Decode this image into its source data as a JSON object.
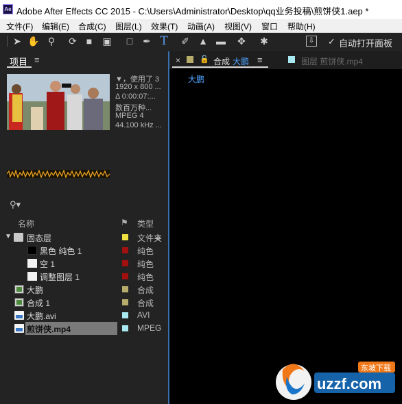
{
  "window": {
    "title": "Adobe After Effects CC 2015 - C:\\Users\\Administrator\\Desktop\\qq业务投稿\\煎饼侠1.aep *",
    "logo_text": "Ae"
  },
  "menu": [
    "文件(F)",
    "编辑(E)",
    "合成(C)",
    "图层(L)",
    "效果(T)",
    "动画(A)",
    "视图(V)",
    "窗口",
    "帮助(H)"
  ],
  "toolbar": {
    "tools": [
      "selection-icon",
      "hand-icon",
      "zoom-icon",
      "rotate-icon",
      "camera-icon",
      "pan-behind-icon",
      "rectangle-icon",
      "pen-icon",
      "text-icon",
      "brush-icon",
      "clone-stamp-icon",
      "eraser-icon",
      "roto-brush-icon",
      "puppet-pin-icon"
    ],
    "auto_open_label": "自动打开面板",
    "auto_open_checked": true
  },
  "project": {
    "tab_label": "项目",
    "tab_menu": "≡",
    "info": [
      "▼，使用了 3",
      "1920 x 800 ...",
      "Δ 0:00:07:...",
      "数百万种...",
      "MPEG 4",
      "44.100 kHz ..."
    ],
    "search_icon": "search-icon",
    "col_name": "名称",
    "col_type": "类型",
    "rows": [
      {
        "name": "固态层",
        "type": "文件夹",
        "icon": "folder-icon",
        "color": "#f0e040",
        "expanded": true
      },
      {
        "name": "黑色 纯色 1",
        "type": "纯色",
        "icon": "solid-black-icon",
        "color": "#a31010"
      },
      {
        "name": "空 1",
        "type": "纯色",
        "icon": "solid-white-icon",
        "color": "#a31010"
      },
      {
        "name": "调整图层 1",
        "type": "纯色",
        "icon": "solid-white-icon",
        "color": "#a31010"
      },
      {
        "name": "大鹏",
        "type": "合成",
        "icon": "composition-icon",
        "color": "#b8ac6c"
      },
      {
        "name": "合成 1",
        "type": "合成",
        "icon": "composition-icon",
        "color": "#b8ac6c"
      },
      {
        "name": "大鹏.avi",
        "type": "AVI",
        "icon": "video-file-icon",
        "color": "#a8e8f0"
      },
      {
        "name": "煎饼侠.mp4",
        "type": "MPEG",
        "icon": "video-file-icon",
        "color": "#a8e8f0",
        "selected": true
      }
    ]
  },
  "composition": {
    "tab_close": "×",
    "tab_prefix": "合成",
    "tab_name": "大鹏",
    "tab_menu": "≡",
    "tab_color": "#b8ac6c",
    "layer_tab_label": "图层 煎饼侠.mp4",
    "layer_tab_color": "#a8e8f0",
    "breadcrumb": "大鹏"
  },
  "watermark": {
    "text": "uzzf.com",
    "subtitle": "东坡下载"
  }
}
